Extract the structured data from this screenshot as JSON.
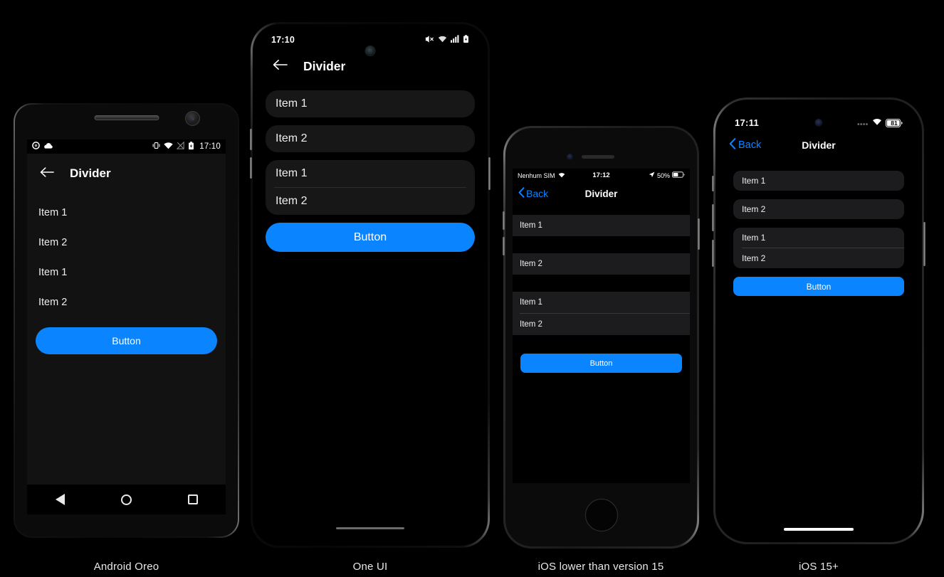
{
  "page": {
    "background": "#000000",
    "accent": "#0a84ff"
  },
  "devices": [
    {
      "id": "android-oreo",
      "caption": "Android Oreo",
      "statusbar": {
        "time": "17:10",
        "left_icons": [
          "record-circle-icon",
          "cloud-icon"
        ],
        "right_icons": [
          "vibrate-icon",
          "wifi-icon",
          "signal-off-icon",
          "battery-charging-icon"
        ]
      },
      "appbar": {
        "back_icon": "arrow-left-icon",
        "title": "Divider"
      },
      "list": [
        {
          "label": "Item 1"
        },
        {
          "label": "Item 2"
        },
        {
          "label": "Item 1"
        },
        {
          "label": "Item 2"
        }
      ],
      "button": {
        "label": "Button"
      },
      "navbar": {
        "back": "nav-back-icon",
        "home": "nav-home-icon",
        "recents": "nav-recents-icon"
      }
    },
    {
      "id": "one-ui",
      "caption": "One UI",
      "statusbar": {
        "time": "17:10",
        "right_icons": [
          "mute-icon",
          "wifi-icon",
          "signal-bars-icon",
          "battery-icon"
        ]
      },
      "appbar": {
        "back_icon": "arrow-left-icon",
        "title": "Divider"
      },
      "cards": [
        {
          "rows": [
            "Item 1"
          ],
          "divided": false
        },
        {
          "rows": [
            "Item 2"
          ],
          "divided": false
        },
        {
          "rows": [
            "Item 1",
            "Item 2"
          ],
          "divided": true
        }
      ],
      "button": {
        "label": "Button"
      }
    },
    {
      "id": "ios-lower-15",
      "caption": "iOS lower than version 15",
      "statusbar": {
        "carrier": "Nenhum SIM",
        "time": "17:12",
        "battery_percent": "50%",
        "left_icons": [
          "wifi-icon"
        ],
        "right_icons": [
          "location-arrow-icon",
          "battery-icon"
        ]
      },
      "navbar": {
        "back_icon": "chevron-left-icon",
        "back_label": "Back",
        "title": "Divider"
      },
      "sections": [
        {
          "rows": [
            "Item 1"
          ],
          "divided": false
        },
        {
          "rows": [
            "Item 2"
          ],
          "divided": false
        },
        {
          "rows": [
            "Item 1",
            "Item 2"
          ],
          "divided": true
        }
      ],
      "button": {
        "label": "Button"
      }
    },
    {
      "id": "ios-15-plus",
      "caption": "iOS 15+",
      "statusbar": {
        "time": "17:11",
        "battery_level": "81",
        "right_icons": [
          "signal-dots-icon",
          "wifi-icon",
          "battery-icon"
        ]
      },
      "navbar": {
        "back_icon": "chevron-left-icon",
        "back_label": "Back",
        "title": "Divider"
      },
      "cards": [
        {
          "rows": [
            "Item 1"
          ],
          "divided": false
        },
        {
          "rows": [
            "Item 2"
          ],
          "divided": false
        },
        {
          "rows": [
            "Item 1",
            "Item 2"
          ],
          "divided": true
        }
      ],
      "button": {
        "label": "Button"
      }
    }
  ]
}
